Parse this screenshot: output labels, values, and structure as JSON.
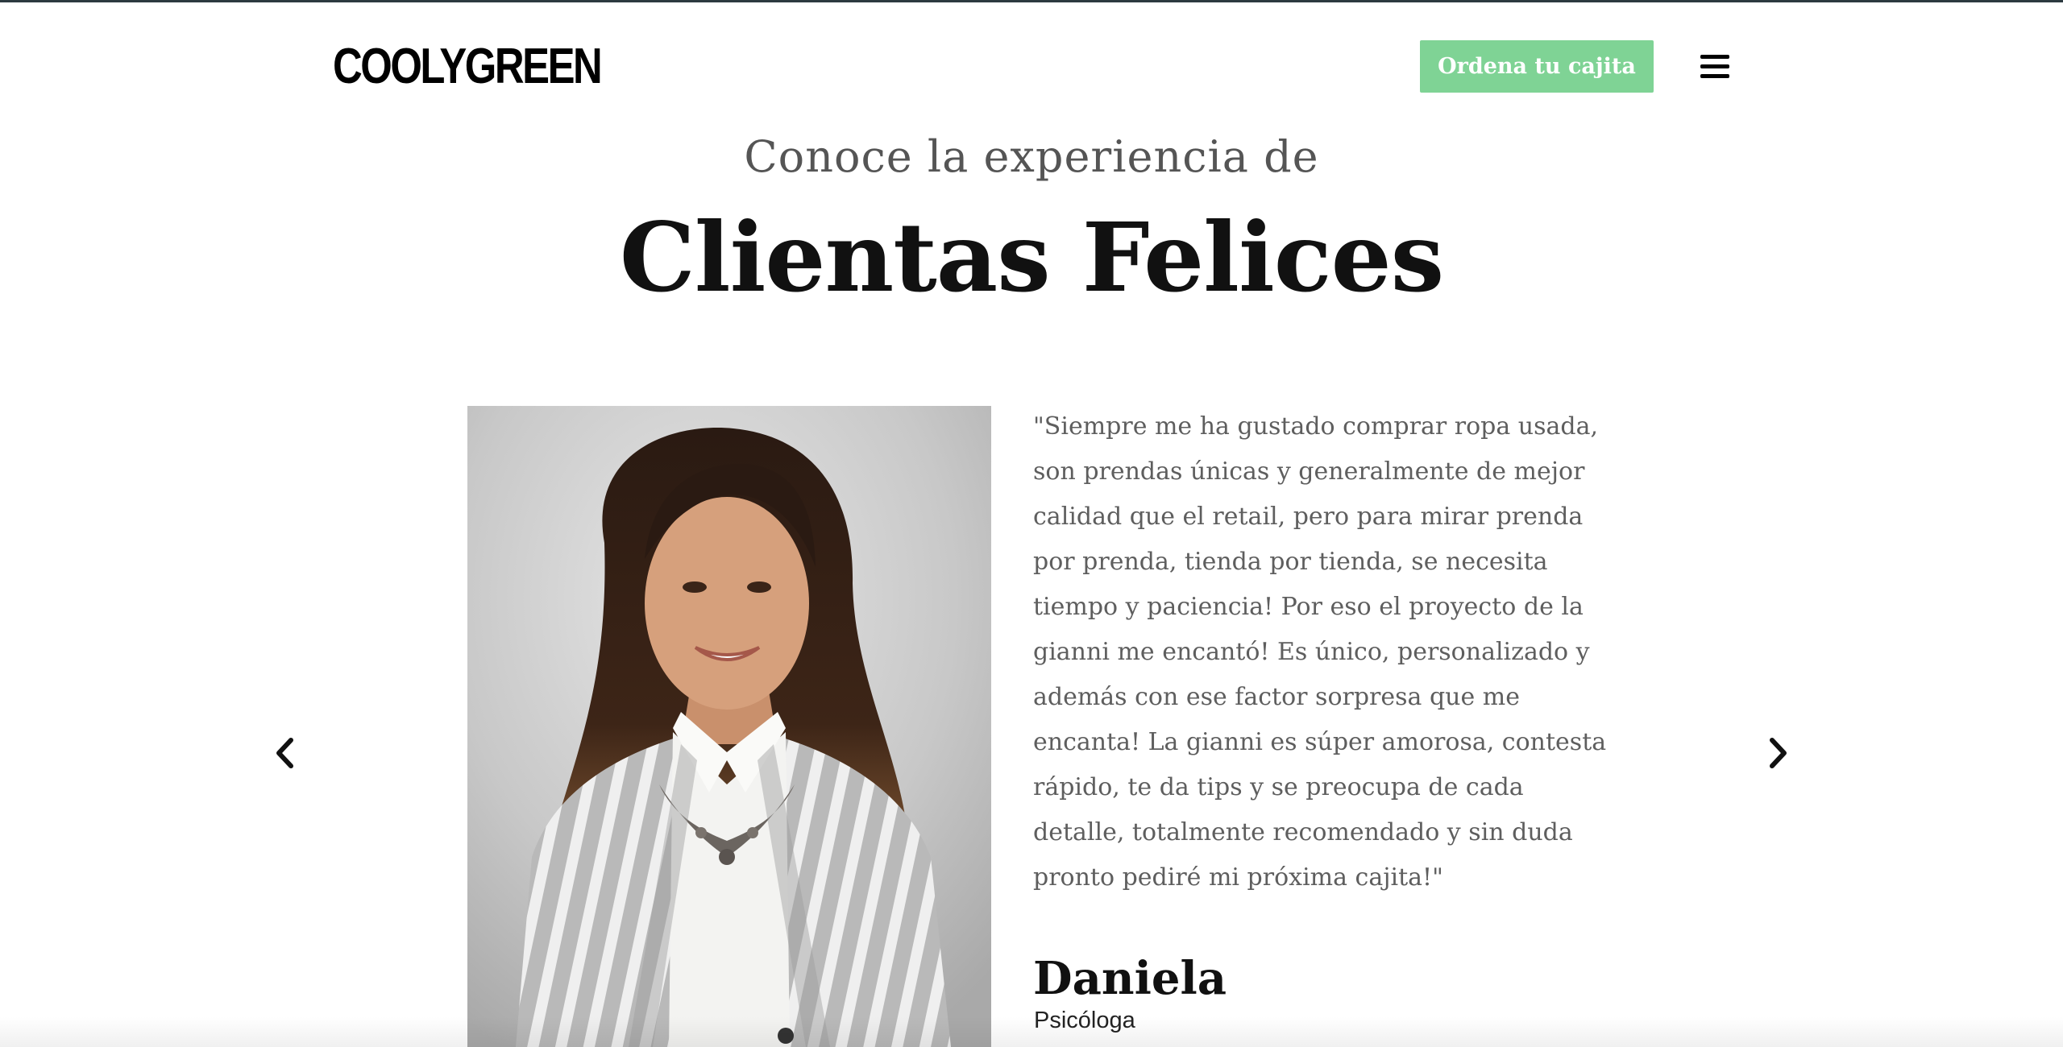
{
  "header": {
    "logo_text": "COOLYGREEN",
    "cta_label": "Ordena tu cajita",
    "menu_icon": "hamburger-menu-icon"
  },
  "section": {
    "kicker": "Conoce la experiencia de",
    "title": "Clientas Felices"
  },
  "testimonial": {
    "photo_description_icon": "portrait-photo",
    "quote": "\"Siempre me ha gustado comprar ropa usada, son prendas únicas y generalmente de mejor calidad que el retail, pero para mirar prenda por prenda, tienda por tienda, se necesita tiempo y paciencia! Por eso el proyecto de la gianni me encantó! Es único, personalizado y además con ese factor sorpresa que me encanta! La gianni es súper amorosa, contesta rápido, te da tips y se preocupa de cada detalle, totalmente recomendado y sin duda pronto pediré mi próxima cajita!\"",
    "name": "Daniela",
    "role": "Psicóloga"
  },
  "carousel": {
    "prev_icon": "chevron-left-icon",
    "next_icon": "chevron-right-icon"
  },
  "colors": {
    "accent": "#7fd395",
    "text_dark": "#111111",
    "text_muted": "#5e5e5e"
  }
}
